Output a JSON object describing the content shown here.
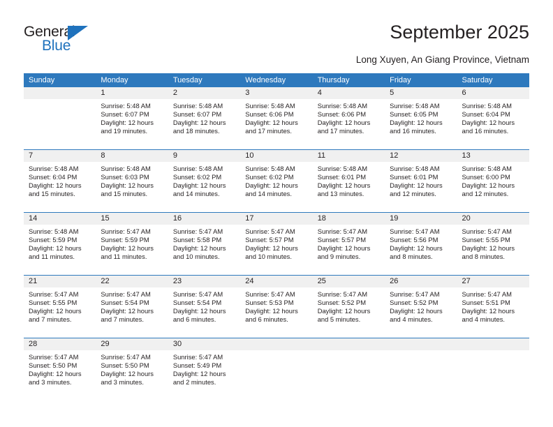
{
  "brand": {
    "name_top": "General",
    "name_bottom": "Blue",
    "triangle_icon": "triangle-icon",
    "accent_color": "#1f72bd"
  },
  "header": {
    "title": "September 2025",
    "location": "Long Xuyen, An Giang Province, Vietnam"
  },
  "calendar": {
    "header_color": "#2e79bd",
    "daynum_band_color": "#f0f0f0",
    "weekdays": [
      "Sunday",
      "Monday",
      "Tuesday",
      "Wednesday",
      "Thursday",
      "Friday",
      "Saturday"
    ],
    "weeks": [
      {
        "days": [
          {
            "num": "",
            "sunrise": "",
            "sunset": "",
            "daylight_line1": "",
            "daylight_line2": "",
            "empty": true
          },
          {
            "num": "1",
            "sunrise": "Sunrise: 5:48 AM",
            "sunset": "Sunset: 6:07 PM",
            "daylight_line1": "Daylight: 12 hours",
            "daylight_line2": "and 19 minutes."
          },
          {
            "num": "2",
            "sunrise": "Sunrise: 5:48 AM",
            "sunset": "Sunset: 6:07 PM",
            "daylight_line1": "Daylight: 12 hours",
            "daylight_line2": "and 18 minutes."
          },
          {
            "num": "3",
            "sunrise": "Sunrise: 5:48 AM",
            "sunset": "Sunset: 6:06 PM",
            "daylight_line1": "Daylight: 12 hours",
            "daylight_line2": "and 17 minutes."
          },
          {
            "num": "4",
            "sunrise": "Sunrise: 5:48 AM",
            "sunset": "Sunset: 6:06 PM",
            "daylight_line1": "Daylight: 12 hours",
            "daylight_line2": "and 17 minutes."
          },
          {
            "num": "5",
            "sunrise": "Sunrise: 5:48 AM",
            "sunset": "Sunset: 6:05 PM",
            "daylight_line1": "Daylight: 12 hours",
            "daylight_line2": "and 16 minutes."
          },
          {
            "num": "6",
            "sunrise": "Sunrise: 5:48 AM",
            "sunset": "Sunset: 6:04 PM",
            "daylight_line1": "Daylight: 12 hours",
            "daylight_line2": "and 16 minutes."
          }
        ]
      },
      {
        "days": [
          {
            "num": "7",
            "sunrise": "Sunrise: 5:48 AM",
            "sunset": "Sunset: 6:04 PM",
            "daylight_line1": "Daylight: 12 hours",
            "daylight_line2": "and 15 minutes."
          },
          {
            "num": "8",
            "sunrise": "Sunrise: 5:48 AM",
            "sunset": "Sunset: 6:03 PM",
            "daylight_line1": "Daylight: 12 hours",
            "daylight_line2": "and 15 minutes."
          },
          {
            "num": "9",
            "sunrise": "Sunrise: 5:48 AM",
            "sunset": "Sunset: 6:02 PM",
            "daylight_line1": "Daylight: 12 hours",
            "daylight_line2": "and 14 minutes."
          },
          {
            "num": "10",
            "sunrise": "Sunrise: 5:48 AM",
            "sunset": "Sunset: 6:02 PM",
            "daylight_line1": "Daylight: 12 hours",
            "daylight_line2": "and 14 minutes."
          },
          {
            "num": "11",
            "sunrise": "Sunrise: 5:48 AM",
            "sunset": "Sunset: 6:01 PM",
            "daylight_line1": "Daylight: 12 hours",
            "daylight_line2": "and 13 minutes."
          },
          {
            "num": "12",
            "sunrise": "Sunrise: 5:48 AM",
            "sunset": "Sunset: 6:01 PM",
            "daylight_line1": "Daylight: 12 hours",
            "daylight_line2": "and 12 minutes."
          },
          {
            "num": "13",
            "sunrise": "Sunrise: 5:48 AM",
            "sunset": "Sunset: 6:00 PM",
            "daylight_line1": "Daylight: 12 hours",
            "daylight_line2": "and 12 minutes."
          }
        ]
      },
      {
        "days": [
          {
            "num": "14",
            "sunrise": "Sunrise: 5:48 AM",
            "sunset": "Sunset: 5:59 PM",
            "daylight_line1": "Daylight: 12 hours",
            "daylight_line2": "and 11 minutes."
          },
          {
            "num": "15",
            "sunrise": "Sunrise: 5:47 AM",
            "sunset": "Sunset: 5:59 PM",
            "daylight_line1": "Daylight: 12 hours",
            "daylight_line2": "and 11 minutes."
          },
          {
            "num": "16",
            "sunrise": "Sunrise: 5:47 AM",
            "sunset": "Sunset: 5:58 PM",
            "daylight_line1": "Daylight: 12 hours",
            "daylight_line2": "and 10 minutes."
          },
          {
            "num": "17",
            "sunrise": "Sunrise: 5:47 AM",
            "sunset": "Sunset: 5:57 PM",
            "daylight_line1": "Daylight: 12 hours",
            "daylight_line2": "and 10 minutes."
          },
          {
            "num": "18",
            "sunrise": "Sunrise: 5:47 AM",
            "sunset": "Sunset: 5:57 PM",
            "daylight_line1": "Daylight: 12 hours",
            "daylight_line2": "and 9 minutes."
          },
          {
            "num": "19",
            "sunrise": "Sunrise: 5:47 AM",
            "sunset": "Sunset: 5:56 PM",
            "daylight_line1": "Daylight: 12 hours",
            "daylight_line2": "and 8 minutes."
          },
          {
            "num": "20",
            "sunrise": "Sunrise: 5:47 AM",
            "sunset": "Sunset: 5:55 PM",
            "daylight_line1": "Daylight: 12 hours",
            "daylight_line2": "and 8 minutes."
          }
        ]
      },
      {
        "days": [
          {
            "num": "21",
            "sunrise": "Sunrise: 5:47 AM",
            "sunset": "Sunset: 5:55 PM",
            "daylight_line1": "Daylight: 12 hours",
            "daylight_line2": "and 7 minutes."
          },
          {
            "num": "22",
            "sunrise": "Sunrise: 5:47 AM",
            "sunset": "Sunset: 5:54 PM",
            "daylight_line1": "Daylight: 12 hours",
            "daylight_line2": "and 7 minutes."
          },
          {
            "num": "23",
            "sunrise": "Sunrise: 5:47 AM",
            "sunset": "Sunset: 5:54 PM",
            "daylight_line1": "Daylight: 12 hours",
            "daylight_line2": "and 6 minutes."
          },
          {
            "num": "24",
            "sunrise": "Sunrise: 5:47 AM",
            "sunset": "Sunset: 5:53 PM",
            "daylight_line1": "Daylight: 12 hours",
            "daylight_line2": "and 6 minutes."
          },
          {
            "num": "25",
            "sunrise": "Sunrise: 5:47 AM",
            "sunset": "Sunset: 5:52 PM",
            "daylight_line1": "Daylight: 12 hours",
            "daylight_line2": "and 5 minutes."
          },
          {
            "num": "26",
            "sunrise": "Sunrise: 5:47 AM",
            "sunset": "Sunset: 5:52 PM",
            "daylight_line1": "Daylight: 12 hours",
            "daylight_line2": "and 4 minutes."
          },
          {
            "num": "27",
            "sunrise": "Sunrise: 5:47 AM",
            "sunset": "Sunset: 5:51 PM",
            "daylight_line1": "Daylight: 12 hours",
            "daylight_line2": "and 4 minutes."
          }
        ]
      },
      {
        "days": [
          {
            "num": "28",
            "sunrise": "Sunrise: 5:47 AM",
            "sunset": "Sunset: 5:50 PM",
            "daylight_line1": "Daylight: 12 hours",
            "daylight_line2": "and 3 minutes."
          },
          {
            "num": "29",
            "sunrise": "Sunrise: 5:47 AM",
            "sunset": "Sunset: 5:50 PM",
            "daylight_line1": "Daylight: 12 hours",
            "daylight_line2": "and 3 minutes."
          },
          {
            "num": "30",
            "sunrise": "Sunrise: 5:47 AM",
            "sunset": "Sunset: 5:49 PM",
            "daylight_line1": "Daylight: 12 hours",
            "daylight_line2": "and 2 minutes."
          },
          {
            "num": "",
            "sunrise": "",
            "sunset": "",
            "daylight_line1": "",
            "daylight_line2": "",
            "empty": true
          },
          {
            "num": "",
            "sunrise": "",
            "sunset": "",
            "daylight_line1": "",
            "daylight_line2": "",
            "empty": true
          },
          {
            "num": "",
            "sunrise": "",
            "sunset": "",
            "daylight_line1": "",
            "daylight_line2": "",
            "empty": true
          },
          {
            "num": "",
            "sunrise": "",
            "sunset": "",
            "daylight_line1": "",
            "daylight_line2": "",
            "empty": true
          }
        ]
      }
    ]
  }
}
